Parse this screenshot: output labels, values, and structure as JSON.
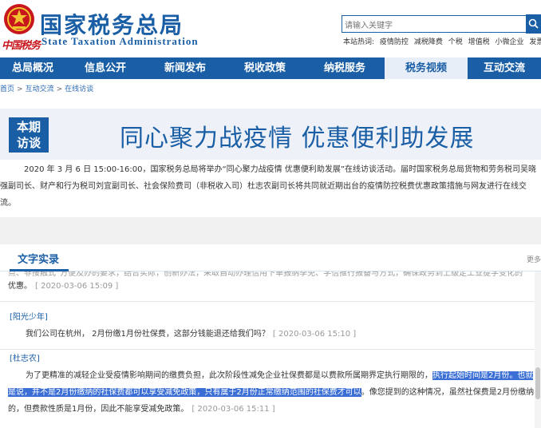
{
  "header": {
    "logo_script": "中国税务",
    "title_cn": "国家税务总局",
    "title_en": "State Taxation Administration",
    "search_placeholder": "请输入关键字",
    "hot_label": "本站热词:",
    "hot_words": [
      "疫情防控",
      "减税降费",
      "个税",
      "增值税",
      "小微企业",
      "发票"
    ]
  },
  "nav": {
    "items": [
      "总局概况",
      "信息公开",
      "新闻发布",
      "税收政策",
      "纳税服务",
      "税务视频",
      "互动交流"
    ],
    "active_index": 5
  },
  "breadcrumb": [
    "首页",
    "互动交流",
    "在线访谈"
  ],
  "banner": {
    "badge_line1": "本期",
    "badge_line2": "访谈",
    "headline": "同心聚力战疫情 优惠便利助发展"
  },
  "intro": {
    "line1": "2020 年 3 月 6 日 15:00-16:00，国家税务总局将举办“同心聚力战疫情 优惠便利助发展”在线访谈活动。届时国家税务总局货物和劳务税司吴晓",
    "line2": "强副司长、财产和行为税司刘宜副司长、社会保险费司（非税收入司）杜志农副司长将共同就近期出台的疫情防控税费优惠政策措施与网友进行在线交",
    "line3": "流。"
  },
  "transcript": {
    "tab_title": "文字实录",
    "more": "更多",
    "block1": {
      "cut_line": "点、非接触式“方便及办的要求，结合实际，创新办法，采取自动办理信用下单报纳季免、学信推行报备与方式，确保政务到上级定工业提学变化的",
      "text": "优惠。",
      "time": "[ 2020-03-06 15:09 ]"
    },
    "block2": {
      "speaker": "[阳光少年]",
      "text": "我们公司在杭州， 2月份缴1月份社保费，这部分钱能退还给我们吗？",
      "time": "[ 2020-03-06 15:10 ]"
    },
    "block3": {
      "speaker": "[杜志农]",
      "line1_plain": "为了更精准的减轻企业受疫情影响期间的缴费负担，此次阶段性减免企业社保费都是以费款所属期界定执行期限的，",
      "line1_hl": "执行起始时间是2月份。也就",
      "line2_hl": "是说，并不是2月份缴纳的社保费都可以享受减免政策，只有属于2月份正常缴纳范围的社保费才可以",
      "line2_plain": "。像您提到的这种情况，虽然社保费是2月份缴纳",
      "line3": "的，但费款性质是1月份，因此不能享受减免政策。",
      "time": "[ 2020-03-06 15:11 ]"
    }
  },
  "colors": {
    "brand_blue": "#1a5ea5",
    "red": "#c8161d",
    "highlight": "#3b6fd6"
  }
}
